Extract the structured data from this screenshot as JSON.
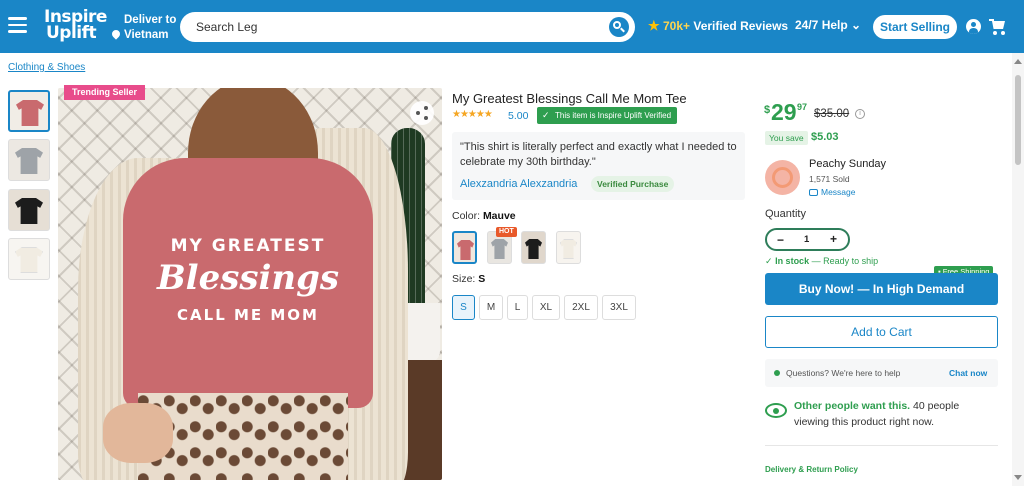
{
  "header": {
    "logo_line1": "Inspire",
    "logo_line2": "Uplift",
    "deliver_label": "Deliver to",
    "deliver_location": "Vietnam",
    "search_value": "Search Leg",
    "reviews_count": "70k+",
    "reviews_label": "Verified Reviews",
    "help_label": "24/7 Help ⌄",
    "start_selling_label": "Start Selling",
    "icons": [
      "menu-icon",
      "location-pin-icon",
      "search-icon",
      "star-icon",
      "user-icon",
      "cart-icon"
    ]
  },
  "breadcrumb": "Clothing & Shoes",
  "gallery": {
    "badge": "Trending Seller",
    "shirt_line1": "MY GREATEST",
    "shirt_line2": "Blessings",
    "shirt_line3": "CALL ME MOM",
    "thumbnails": [
      {
        "color": "#c96a6e"
      },
      {
        "color": "#9ea3a8"
      },
      {
        "color": "#1c1c1c"
      },
      {
        "color": "#f1ece2"
      }
    ]
  },
  "product": {
    "title": "My Greatest Blessings Call Me Mom Tee",
    "stars": "★★★★★",
    "rating": "5.00",
    "verified_badge": "This item is Inspire Uplift Verified",
    "review_text": "\"This shirt is literally perfect and exactly what I needed to celebrate my 30th birthday.\"",
    "reviewer": "Alexzandria Alexzandria",
    "verified_purchase": "Verified Purchase",
    "color_label": "Color:",
    "color_value": "Mauve",
    "hot_label": "HOT",
    "size_label": "Size:",
    "size_value": "S",
    "sizes": [
      "S",
      "M",
      "L",
      "XL",
      "2XL",
      "3XL"
    ]
  },
  "purchase": {
    "currency": "$",
    "price_dollars": "29",
    "price_cents": "97",
    "price_old": "$35.00",
    "you_save_label": "You save",
    "you_save_amount": "$5.03",
    "seller_name": "Peachy Sunday",
    "seller_sold": "1,571 Sold",
    "message_label": "Message",
    "quantity_label": "Quantity",
    "quantity_value": "1",
    "stock_status": "In stock",
    "stock_note": "— Ready to ship",
    "free_shipping": "Free Shipping",
    "buy_now_label": "Buy Now! — In High Demand",
    "add_to_cart_label": "Add to Cart",
    "chat_question": "Questions? We're here to help",
    "chat_now_label": "Chat now",
    "others_highlight": "Other people want this.",
    "others_text": "40 people viewing this product right now.",
    "delivery_policy": "Delivery & Return Policy"
  },
  "colors": {
    "brand_blue": "#1a86c7",
    "price_green": "#2e9e4f",
    "trending_pink": "#e84c8b"
  }
}
